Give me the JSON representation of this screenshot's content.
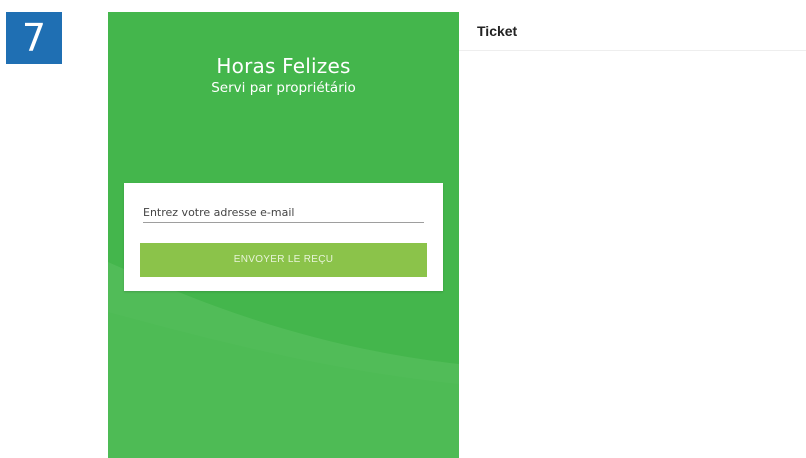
{
  "step_badge": "7",
  "brand": {
    "title": "Horas Felizes",
    "subtitle": "Servi par propriétário"
  },
  "form": {
    "email_placeholder": "Entrez votre adresse e-mail",
    "email_value": "",
    "send_label": "ENVOYER LE REÇU"
  },
  "ticket": {
    "title": "Ticket"
  },
  "colors": {
    "panel_green": "#44b64c",
    "button_green": "#8bc34a",
    "badge_blue": "#1f6fb3"
  }
}
